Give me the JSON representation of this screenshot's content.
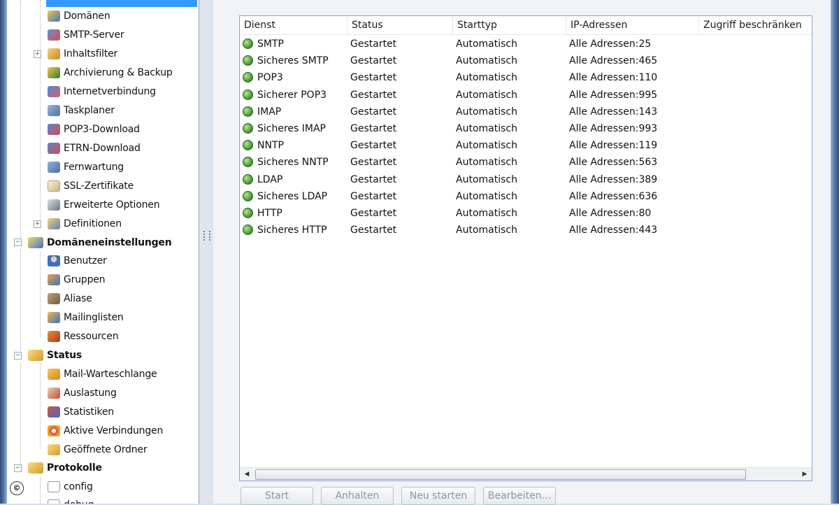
{
  "sidebar": {
    "top_selected": "",
    "items": [
      {
        "label": "Domänen",
        "icon": "domains-icon"
      },
      {
        "label": "SMTP-Server",
        "icon": "smtp-server-icon"
      },
      {
        "label": "Inhaltsfilter",
        "icon": "content-filter-icon"
      },
      {
        "label": "Archivierung & Backup",
        "icon": "archive-backup-icon"
      },
      {
        "label": "Internetverbindung",
        "icon": "internet-connection-icon"
      },
      {
        "label": "Taskplaner",
        "icon": "task-scheduler-icon"
      },
      {
        "label": "POP3-Download",
        "icon": "pop3-download-icon"
      },
      {
        "label": "ETRN-Download",
        "icon": "etrn-download-icon"
      },
      {
        "label": "Fernwartung",
        "icon": "remote-admin-icon"
      },
      {
        "label": "SSL-Zertifikate",
        "icon": "ssl-certificate-icon"
      },
      {
        "label": "Erweiterte Optionen",
        "icon": "advanced-options-icon"
      },
      {
        "label": "Definitionen",
        "icon": "definitions-icon"
      },
      {
        "label": "Domäneneinstellungen",
        "icon": "domain-settings-icon"
      },
      {
        "label": "Benutzer",
        "icon": "user-icon"
      },
      {
        "label": "Gruppen",
        "icon": "groups-icon"
      },
      {
        "label": "Aliase",
        "icon": "aliases-icon"
      },
      {
        "label": "Mailinglisten",
        "icon": "mailing-lists-icon"
      },
      {
        "label": "Ressourcen",
        "icon": "resources-icon"
      },
      {
        "label": "Status",
        "icon": "status-folder-icon"
      },
      {
        "label": "Mail-Warteschlange",
        "icon": "mail-queue-icon"
      },
      {
        "label": "Auslastung",
        "icon": "load-icon"
      },
      {
        "label": "Statistiken",
        "icon": "statistics-icon"
      },
      {
        "label": "Aktive Verbindungen",
        "icon": "active-connections-icon"
      },
      {
        "label": "Geöffnete Ordner",
        "icon": "open-folders-icon"
      },
      {
        "label": "Protokolle",
        "icon": "logs-folder-icon"
      },
      {
        "label": "config",
        "icon": "log-file-icon"
      },
      {
        "label": "debug",
        "icon": "log-file-icon"
      }
    ]
  },
  "table": {
    "columns": [
      "Dienst",
      "Status",
      "Starttyp",
      "IP-Adressen",
      "Zugriff beschränken"
    ],
    "rows": [
      [
        "SMTP",
        "Gestartet",
        "Automatisch",
        "Alle Adressen:25"
      ],
      [
        "Sicheres SMTP",
        "Gestartet",
        "Automatisch",
        "Alle Adressen:465"
      ],
      [
        "POP3",
        "Gestartet",
        "Automatisch",
        "Alle Adressen:110"
      ],
      [
        "Sicherer POP3",
        "Gestartet",
        "Automatisch",
        "Alle Adressen:995"
      ],
      [
        "IMAP",
        "Gestartet",
        "Automatisch",
        "Alle Adressen:143"
      ],
      [
        "Sicheres IMAP",
        "Gestartet",
        "Automatisch",
        "Alle Adressen:993"
      ],
      [
        "NNTP",
        "Gestartet",
        "Automatisch",
        "Alle Adressen:119"
      ],
      [
        "Sicheres NNTP",
        "Gestartet",
        "Automatisch",
        "Alle Adressen:563"
      ],
      [
        "LDAP",
        "Gestartet",
        "Automatisch",
        "Alle Adressen:389"
      ],
      [
        "Sicheres LDAP",
        "Gestartet",
        "Automatisch",
        "Alle Adressen:636"
      ],
      [
        "HTTP",
        "Gestartet",
        "Automatisch",
        "Alle Adressen:80"
      ],
      [
        "Sicheres HTTP",
        "Gestartet",
        "Automatisch",
        "Alle Adressen:443"
      ]
    ]
  },
  "buttons": {
    "start": "Start",
    "stop": "Anhalten",
    "restart": "Neu starten",
    "edit": "Bearbeiten..."
  },
  "badge": "©",
  "colors": {
    "selection": "#3399ff",
    "window_frame": "#2e4d78",
    "service_running": "#3f8e2c"
  }
}
